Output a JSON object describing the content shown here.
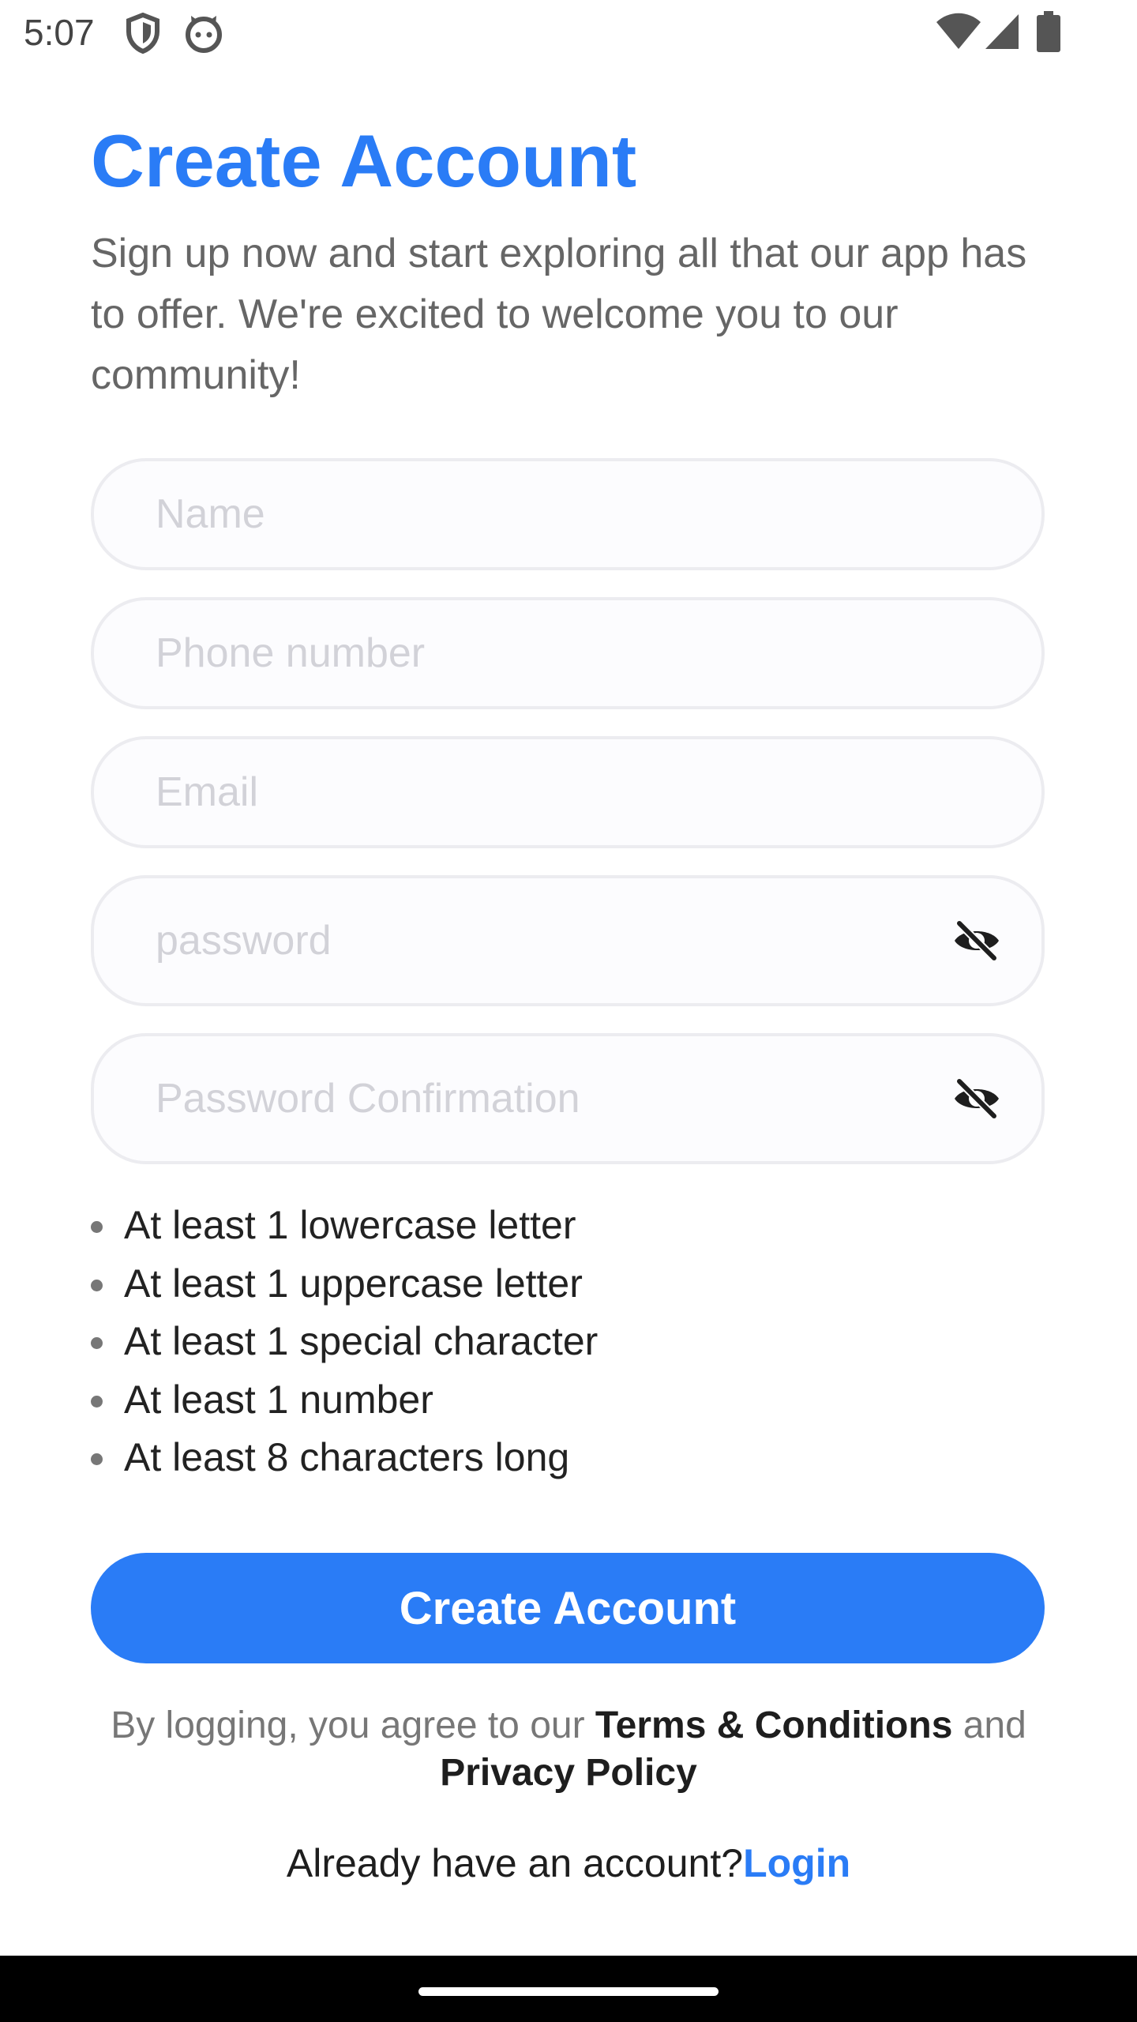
{
  "status_bar": {
    "time": "5:07",
    "icons": [
      "shield-icon",
      "cat-face-icon",
      "wifi-icon",
      "signal-icon",
      "battery-icon"
    ]
  },
  "header": {
    "title": "Create Account",
    "subtitle": "Sign up now and start exploring all that our app has to offer. We're excited to welcome you to our community!"
  },
  "form": {
    "name_placeholder": "Name",
    "phone_placeholder": "Phone number",
    "email_placeholder": "Email",
    "password_placeholder": "password",
    "password_confirmation_placeholder": "Password Confirmation",
    "toggle_icon": "eye-off-icon"
  },
  "password_rules": [
    "At least 1 lowercase letter",
    "At least 1 uppercase letter",
    "At least 1 special character",
    "At least 1 number",
    "At least 8 characters long"
  ],
  "actions": {
    "create_account_label": "Create Account"
  },
  "terms": {
    "prefix": "By logging, you agree to our ",
    "terms_link": "Terms & Conditions",
    "conjunction": " and",
    "privacy_link": "Privacy Policy"
  },
  "login_prompt": {
    "text": "Already have an account?",
    "link": "Login"
  },
  "colors": {
    "accent": "#2a7cf6",
    "subtitle_text": "#666666",
    "field_border": "#ececf0",
    "placeholder": "#d2d2d8"
  }
}
